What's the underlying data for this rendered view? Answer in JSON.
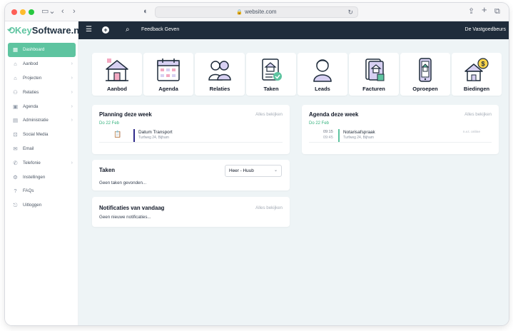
{
  "browser": {
    "url": "website.com"
  },
  "logo": {
    "prefix": "Key",
    "suffix": "Software.nl"
  },
  "sidebar": {
    "items": [
      {
        "label": "Dashboard",
        "icon": "dashboard-icon",
        "active": true,
        "has_children": false
      },
      {
        "label": "Aanbod",
        "icon": "home-icon",
        "has_children": true
      },
      {
        "label": "Projecten",
        "icon": "building-icon",
        "has_children": true
      },
      {
        "label": "Relaties",
        "icon": "people-icon",
        "has_children": true
      },
      {
        "label": "Agenda",
        "icon": "calendar-icon",
        "has_children": true
      },
      {
        "label": "Administratie",
        "icon": "document-icon",
        "has_children": true
      },
      {
        "label": "Social Media",
        "icon": "share-icon",
        "has_children": false
      },
      {
        "label": "Email",
        "icon": "mail-icon",
        "has_children": false
      },
      {
        "label": "Telefonie",
        "icon": "phone-icon",
        "has_children": true
      },
      {
        "label": "Instellingen",
        "icon": "gear-icon",
        "has_children": false
      },
      {
        "label": "FAQs",
        "icon": "help-icon",
        "has_children": false
      },
      {
        "label": "Uitloggen",
        "icon": "logout-icon",
        "has_children": false
      }
    ]
  },
  "topbar": {
    "feedback": "Feedback Geven",
    "user": "De Vastgoedbeurs"
  },
  "tiles": [
    {
      "label": "Aanbod",
      "icon": "house-icon"
    },
    {
      "label": "Agenda",
      "icon": "calendar-icon"
    },
    {
      "label": "Relaties",
      "icon": "people-icon"
    },
    {
      "label": "Taken",
      "icon": "tasks-icon"
    },
    {
      "label": "Leads",
      "icon": "person-icon"
    },
    {
      "label": "Facturen",
      "icon": "invoice-icon"
    },
    {
      "label": "Oproepen",
      "icon": "phone-icon"
    },
    {
      "label": "Biedingen",
      "icon": "bid-house-icon"
    }
  ],
  "planning": {
    "title": "Planning deze week",
    "link": "Alles bekijken",
    "date": "Do 22 Feb",
    "event": {
      "title": "Datum Transport",
      "address": "Turfweg 24, Bijham"
    }
  },
  "agenda": {
    "title": "Agenda deze week",
    "link": "Alles bekijken",
    "date": "Do 22 Feb",
    "event": {
      "start": "09:15",
      "end": "09:45",
      "title": "Notarisafspraak",
      "address": "Turfweg 24, Bijham",
      "status": "n.v.t. online"
    }
  },
  "taken": {
    "title": "Taken",
    "select_value": "Heer - Huub",
    "empty": "Geen taken gevonden..."
  },
  "notificaties": {
    "title": "Notificaties van vandaag",
    "link": "Alles bekijken",
    "empty": "Geen nieuwe notificaties..."
  },
  "colors": {
    "accent": "#5ec4a0",
    "topbar": "#1f2c3b",
    "tile_icon_primary": "#1f2c3b",
    "tile_icon_fill": "#d7d0f2",
    "tile_icon_pink": "#f4a9c2",
    "tile_icon_green": "#5ec4a0",
    "tile_icon_yellow": "#f7d34a"
  }
}
